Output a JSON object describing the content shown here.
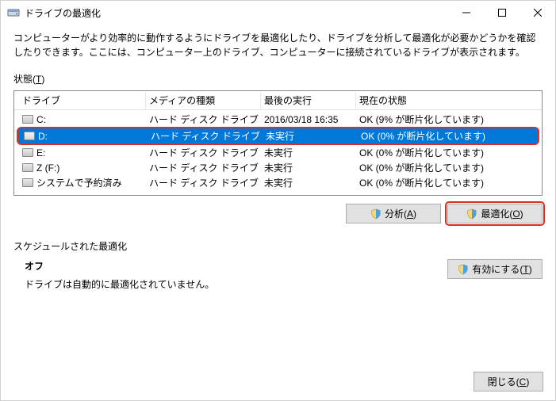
{
  "titlebar": {
    "title": "ドライブの最適化"
  },
  "description": "コンピューターがより効率的に動作するようにドライブを最適化したり、ドライブを分析して最適化が必要かどうかを確認したりできます。ここには、コンピューター上のドライブ、コンピューターに接続されているドライブが表示されます。",
  "status_label_prefix": "状態(",
  "status_label_u": "T",
  "status_label_suffix": ")",
  "columns": {
    "c0": "ドライブ",
    "c1": "メディアの種類",
    "c2": "最後の実行",
    "c3": "現在の状態"
  },
  "rows": [
    {
      "drive": "C:",
      "media": "ハード ディスク ドライブ",
      "last": "2016/03/18 16:35",
      "status": "OK (9% が断片化しています)",
      "selected": false
    },
    {
      "drive": "D:",
      "media": "ハード ディスク ドライブ",
      "last": "未実行",
      "status": "OK (0% が断片化しています)",
      "selected": true,
      "highlight": true
    },
    {
      "drive": "E:",
      "media": "ハード ディスク ドライブ",
      "last": "未実行",
      "status": "OK (0% が断片化しています)",
      "selected": false
    },
    {
      "drive": "Z (F:)",
      "media": "ハード ディスク ドライブ",
      "last": "未実行",
      "status": "OK (0% が断片化しています)",
      "selected": false
    },
    {
      "drive": "システムで予約済み",
      "media": "ハード ディスク ドライブ",
      "last": "未実行",
      "status": "OK (0% が断片化しています)",
      "selected": false
    }
  ],
  "buttons": {
    "analyze_prefix": "分析(",
    "analyze_u": "A",
    "analyze_suffix": ")",
    "optimize_prefix": "最適化(",
    "optimize_u": "O",
    "optimize_suffix": ")",
    "enable_prefix": "有効にする(",
    "enable_u": "T",
    "enable_suffix": ")",
    "close_prefix": "閉じる(",
    "close_u": "C",
    "close_suffix": ")"
  },
  "schedule": {
    "label": "スケジュールされた最適化",
    "state": "オフ",
    "detail": "ドライブは自動的に最適化されていません。"
  }
}
